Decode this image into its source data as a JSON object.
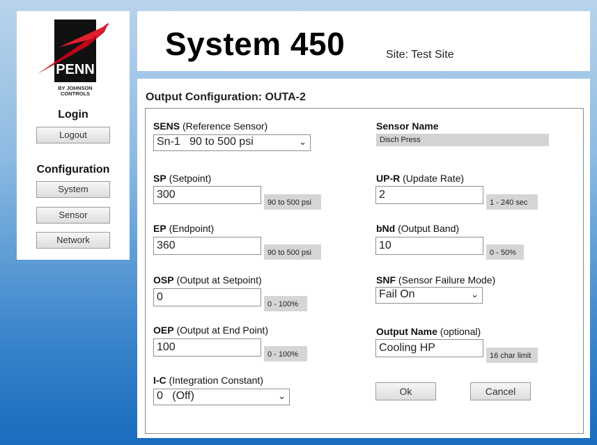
{
  "brand": {
    "logo_text": "PENN",
    "logo_subtext": "BY JOHNSON CONTROLS",
    "red": "#d0021b"
  },
  "sidebar": {
    "login_title": "Login",
    "logout_label": "Logout",
    "config_title": "Configuration",
    "items": [
      {
        "label": "System"
      },
      {
        "label": "Sensor"
      },
      {
        "label": "Network"
      }
    ]
  },
  "header": {
    "title": "System 450",
    "site": "Site: Test Site"
  },
  "page": {
    "title": "Output Configuration: OUTA-2"
  },
  "form": {
    "sens": {
      "code": "SENS",
      "desc": " (Reference Sensor)",
      "value": "Sn-1   90 to 500 psi"
    },
    "sensor_name": {
      "label": "Sensor Name",
      "value": "Disch Press"
    },
    "sp": {
      "code": "SP",
      "desc": " (Setpoint)",
      "value": "300",
      "range": "90 to 500 psi"
    },
    "upr": {
      "code": "UP-R",
      "desc": " (Update Rate)",
      "value": "2",
      "range": "1 - 240 sec"
    },
    "ep": {
      "code": "EP",
      "desc": " (Endpoint)",
      "value": "360",
      "range": "90 to 500 psi"
    },
    "bnd": {
      "code": "bNd",
      "desc": " (Output Band)",
      "value": "10",
      "range": "0 - 50%"
    },
    "osp": {
      "code": "OSP",
      "desc": " (Output at Setpoint)",
      "value": "0",
      "range": "0 - 100%"
    },
    "snf": {
      "code": "SNF",
      "desc": " (Sensor Failure Mode)",
      "value": "Fail On"
    },
    "oep": {
      "code": "OEP",
      "desc": " (Output at End Point)",
      "value": "100",
      "range": "0 - 100%"
    },
    "outname": {
      "code": "Output Name",
      "desc": " (optional)",
      "value": "Cooling HP",
      "range": "16 char limit"
    },
    "ic": {
      "code": "I-C",
      "desc": " (Integration Constant)",
      "value": "0   (Off)"
    },
    "ok_label": "Ok",
    "cancel_label": "Cancel"
  }
}
